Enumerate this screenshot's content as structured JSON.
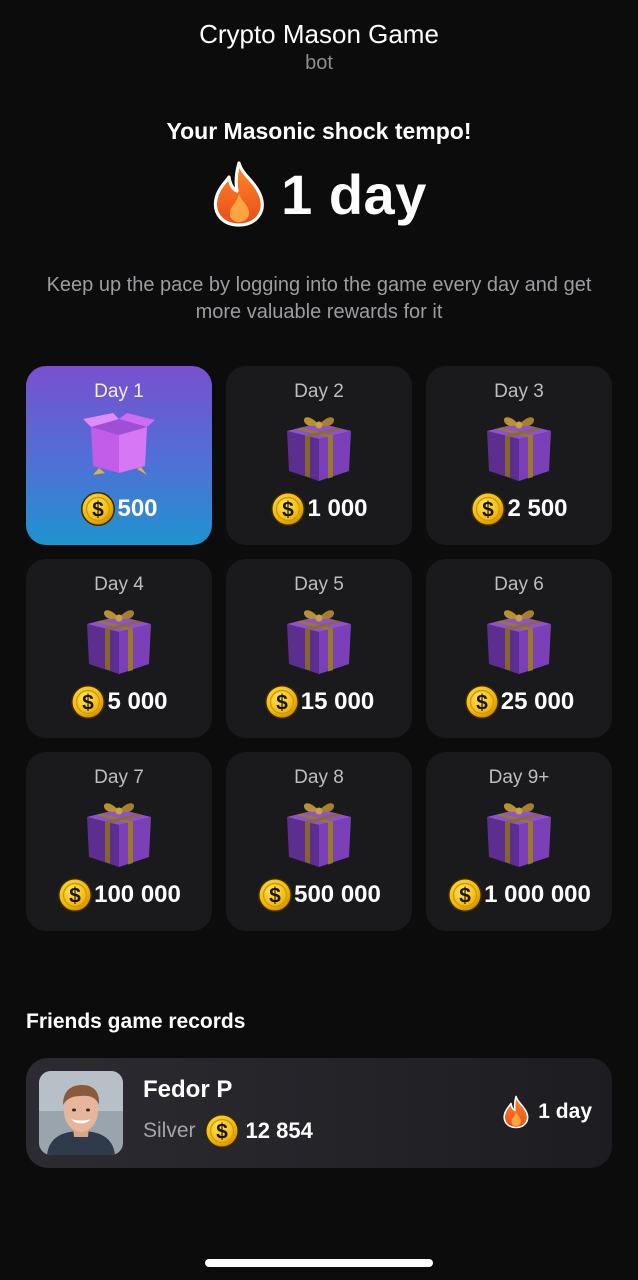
{
  "header": {
    "title": "Crypto Mason Game",
    "subtitle": "bot"
  },
  "streak": {
    "heading": "Your Masonic shock tempo!",
    "value": "1 day",
    "icon": "flame-icon"
  },
  "description": "Keep up the pace by logging into the game every day and get more valuable rewards for it",
  "rewards": [
    {
      "day": "Day 1",
      "amount": "500",
      "icon": "open-box-icon",
      "active": true
    },
    {
      "day": "Day 2",
      "amount": "1 000",
      "icon": "gift-box-icon"
    },
    {
      "day": "Day 3",
      "amount": "2 500",
      "icon": "gift-box-icon"
    },
    {
      "day": "Day 4",
      "amount": "5 000",
      "icon": "gift-box-icon"
    },
    {
      "day": "Day 5",
      "amount": "15 000",
      "icon": "gift-box-icon"
    },
    {
      "day": "Day 6",
      "amount": "25 000",
      "icon": "gift-box-icon"
    },
    {
      "day": "Day 7",
      "amount": "100 000",
      "icon": "gift-box-icon"
    },
    {
      "day": "Day 8",
      "amount": "500 000",
      "icon": "gift-box-icon"
    },
    {
      "day": "Day 9+",
      "amount": "1 000 000",
      "icon": "gift-box-icon"
    }
  ],
  "friends": {
    "title": "Friends game records",
    "items": [
      {
        "name": "Fedor P",
        "league": "Silver",
        "score": "12 854",
        "streak": "1 day"
      }
    ]
  },
  "colors": {
    "background": "#0c0c0d",
    "card": "#1a1a1d",
    "active_gradient_top": "#7a4fd0",
    "active_gradient_bottom": "#1f93cf",
    "coin": "#f5c518",
    "flame": "#f4691f"
  }
}
